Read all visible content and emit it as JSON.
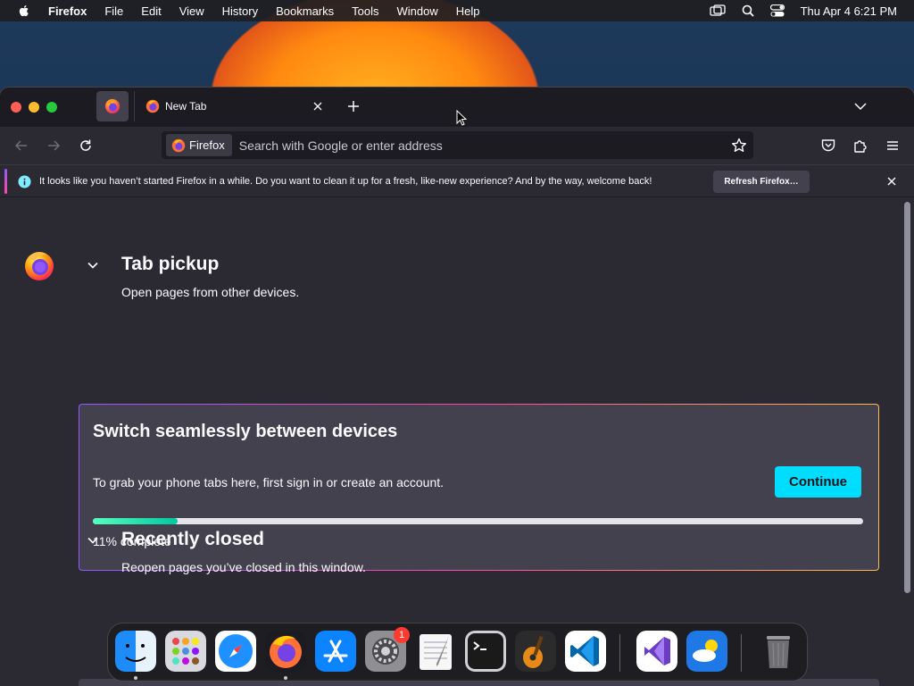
{
  "menubar": {
    "app_name": "Firefox",
    "items": [
      "File",
      "Edit",
      "View",
      "History",
      "Bookmarks",
      "Tools",
      "Window",
      "Help"
    ],
    "clock": "Thu Apr 4  6:21 PM"
  },
  "tabs": {
    "active_title": "New Tab"
  },
  "urlbar": {
    "identity_label": "Firefox",
    "placeholder": "Search with Google or enter address"
  },
  "notification": {
    "message": "It looks like you haven’t started Firefox in a while. Do you want to clean it up for a fresh, like-new experience? And by the way, welcome back!",
    "button_label": "Refresh Firefox…"
  },
  "tab_pickup": {
    "title": "Tab pickup",
    "subtitle": "Open pages from other devices.",
    "card_title": "Switch seamlessly between devices",
    "card_body": "To grab your phone tabs here, first sign in or create an account.",
    "continue_label": "Continue",
    "progress_percent": 11,
    "progress_label": "11% complete"
  },
  "recently_closed": {
    "title": "Recently closed",
    "subtitle": "Reopen pages you’ve closed in this window."
  },
  "dock": {
    "items": [
      "finder",
      "launchpad",
      "safari",
      "firefox",
      "app-store",
      "system-settings",
      "textedit",
      "terminal",
      "garageband",
      "vscode",
      "visual-studio",
      "weather",
      "trash"
    ],
    "settings_badge": "1"
  },
  "colors": {
    "accent_cyan": "#00ddff",
    "progress_green": "#2ac3a2",
    "card_bg": "#42414d",
    "page_bg": "#2b2a33"
  }
}
